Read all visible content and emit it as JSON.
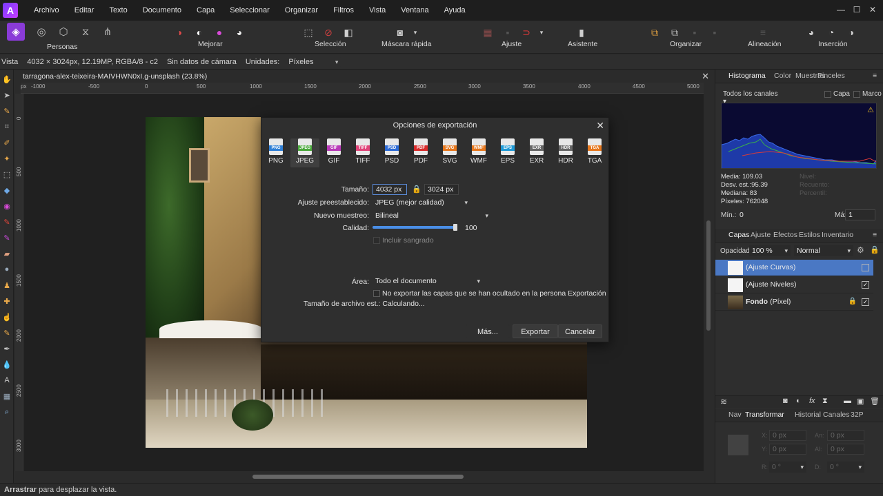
{
  "menubar": {
    "items": [
      "Archivo",
      "Editar",
      "Texto",
      "Documento",
      "Capa",
      "Seleccionar",
      "Organizar",
      "Filtros",
      "Vista",
      "Ventana",
      "Ayuda"
    ]
  },
  "toolbar": {
    "personas_label": "Personas",
    "mejorar_label": "Mejorar",
    "seleccion_label": "Selección",
    "mascara_label": "Máscara rápida",
    "ajuste_label": "Ajuste",
    "asistente_label": "Asistente",
    "organizar_label": "Organizar",
    "alineacion_label": "Alineación",
    "insercion_label": "Inserción"
  },
  "contextbar": {
    "vista": "Vista",
    "info": "4032 × 3024px, 12.19MP, RGBA/8 - c2",
    "camera": "Sin datos de cámara",
    "units_label": "Unidades:",
    "units_value": "Píxeles"
  },
  "document": {
    "tab_title": "tarragona-alex-teixeira-MAIVHWN0xI.g-unsplash (23.8%)",
    "ruler_h_labels": [
      "-1000",
      "-500",
      "0",
      "500",
      "1000",
      "1500",
      "2000",
      "2500",
      "3000",
      "3500",
      "4000",
      "4500",
      "5000"
    ],
    "ruler_v_labels": [
      "0",
      "500",
      "1000",
      "1500",
      "2000",
      "2500",
      "3000"
    ],
    "ruler_unit": "px"
  },
  "dialog": {
    "title": "Opciones de exportación",
    "formats": [
      "PNG",
      "JPEG",
      "GIF",
      "TIFF",
      "PSD",
      "PDF",
      "SVG",
      "WMF",
      "EPS",
      "EXR",
      "HDR",
      "TGA"
    ],
    "selected_format": "JPEG",
    "format_colors": {
      "PNG": "#2f7fd6",
      "JPEG": "#4aa83b",
      "GIF": "#b83ab8",
      "TIFF": "#e0457a",
      "PSD": "#2d6bd6",
      "PDF": "#d92c2c",
      "SVG": "#e7781e",
      "WMF": "#e7781e",
      "EPS": "#1f9ad6",
      "EXR": "#666666",
      "HDR": "#666666",
      "TGA": "#e7781e"
    },
    "size_label": "Tamaño:",
    "width_value": "4032 px",
    "height_value": "3024 px",
    "preset_label": "Ajuste preestablecido:",
    "preset_value": "JPEG (mejor calidad)",
    "resample_label": "Nuevo muestreo:",
    "resample_value": "Bilineal",
    "quality_label": "Calidad:",
    "quality_value": "100",
    "quality_fraction": 1.0,
    "bleed_label": "Incluir sangrado",
    "area_label": "Área:",
    "area_value": "Todo el documento",
    "hidden_layers_label": "No exportar las capas que se han ocultado en la persona Exportación",
    "filesize_label": "Tamaño de archivo est.:",
    "filesize_value": "Calculando...",
    "more_button": "Más...",
    "export_button": "Exportar",
    "cancel_button": "Cancelar"
  },
  "histogram_panel": {
    "tabs": [
      "Histograma",
      "Color",
      "Muestras",
      "Pinceles"
    ],
    "channels": "Todos los canales",
    "capa_label": "Capa",
    "marco_label": "Marco",
    "media": "Media: 109.03",
    "desv": "Desv. est.:95.39",
    "mediana": "Mediana: 83",
    "pixeles": "Píxeles: 762048",
    "nivel": "Nivel:",
    "recuento": "Recuento:",
    "percentil": "Percentil:",
    "min_label": "Mín.:",
    "min_value": "0",
    "max_label": "Máx.:",
    "max_value": "1"
  },
  "layers_panel": {
    "tabs": [
      "Capas",
      "Ajuste",
      "Efectos",
      "Estilos",
      "Inventario"
    ],
    "opacity_label": "Opacidad:",
    "opacity_value": "100 %",
    "blend_mode": "Normal",
    "layers": [
      {
        "name": "(Ajuste Curvas)",
        "selected": true,
        "visible": false
      },
      {
        "name": "(Ajuste Niveles)",
        "selected": false,
        "visible": true
      },
      {
        "name": "Fondo",
        "suffix": "(Píxel)",
        "selected": false,
        "visible": true,
        "locked": true
      }
    ]
  },
  "transform_panel": {
    "tabs": [
      "Nav",
      "Transformar",
      "Historial",
      "Canales",
      "32P"
    ],
    "x_label": "X:",
    "x_value": "0 px",
    "y_label": "Y:",
    "y_value": "0 px",
    "w_label": "An:",
    "w_value": "0 px",
    "h_label": "Al:",
    "h_value": "0 px",
    "r_label": "R:",
    "r_value": "0 °",
    "s_label": "D:",
    "s_value": "0 °"
  },
  "statusbar": {
    "bold": "Arrastrar",
    "text": " para desplazar la vista."
  }
}
